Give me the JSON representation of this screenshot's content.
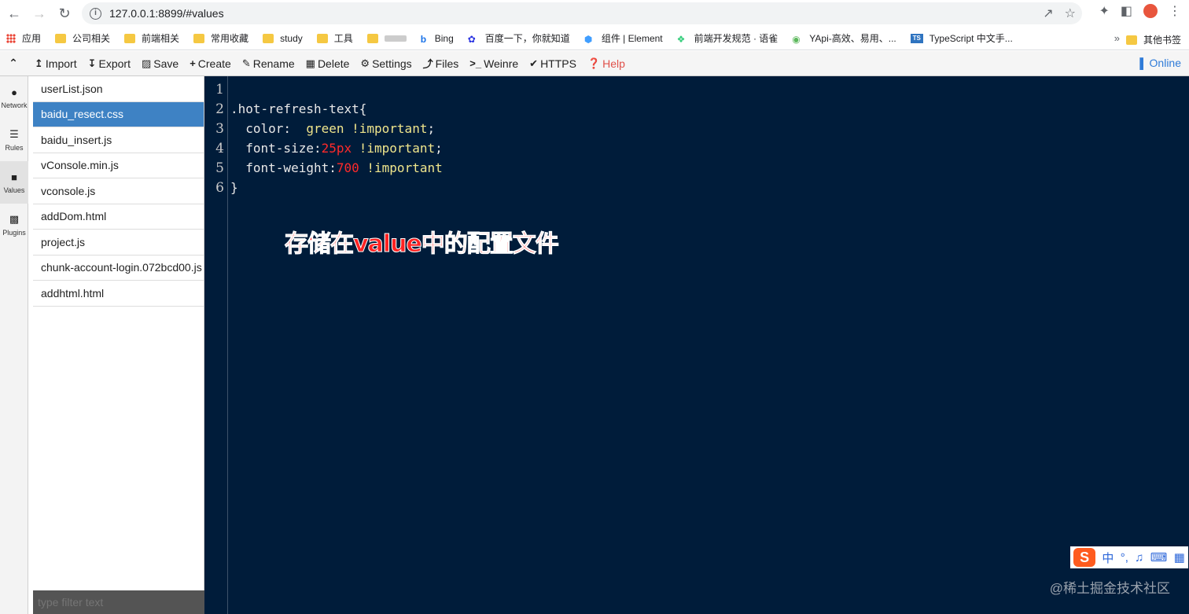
{
  "browser": {
    "url": "127.0.0.1:8899/#values"
  },
  "bookmarks": {
    "items": [
      "应用",
      "公司相关",
      "前端相关",
      "常用收藏",
      "study",
      "工具",
      "",
      "Bing",
      "百度一下，你就知道",
      "组件 | Element",
      "前端开发规范 · 语雀",
      "YApi-高效、易用、...",
      "TypeScript 中文手..."
    ],
    "more": "»",
    "other": "其他书签"
  },
  "toolbar": {
    "import": "Import",
    "export": "Export",
    "save": "Save",
    "create": "Create",
    "rename": "Rename",
    "delete": "Delete",
    "settings": "Settings",
    "files": "Files",
    "weinre": "Weinre",
    "https": "HTTPS",
    "help": "Help",
    "online": "Online"
  },
  "leftnav": {
    "network": "Network",
    "rules": "Rules",
    "values": "Values",
    "plugins": "Plugins"
  },
  "files": [
    "userList.json",
    "baidu_resect.css",
    "baidu_insert.js",
    "vConsole.min.js",
    "vconsole.js",
    "addDom.html",
    "project.js",
    "chunk-account-login.072bcd00.js",
    "addhtml.html"
  ],
  "selected_file": "baidu_resect.css",
  "filter_placeholder": "type filter text",
  "editor": {
    "line_numbers": [
      "1",
      "2",
      "3",
      "4",
      "5",
      "6"
    ],
    "line2": ".hot-refresh-text{",
    "line3_key": "  color:  ",
    "line3_val": "green !important",
    "line3_end": ";",
    "line4_key": "  font-size:",
    "line4_num": "25px",
    "line4_val": " !important",
    "line4_end": ";",
    "line5_key": "  font-weight:",
    "line5_num": "700",
    "line5_val": " !important",
    "line6": "}"
  },
  "annotation": "存储在value中的配置文件",
  "ime": {
    "lang": "中",
    "punct": "°,"
  },
  "watermark": "@稀土掘金技术社区"
}
